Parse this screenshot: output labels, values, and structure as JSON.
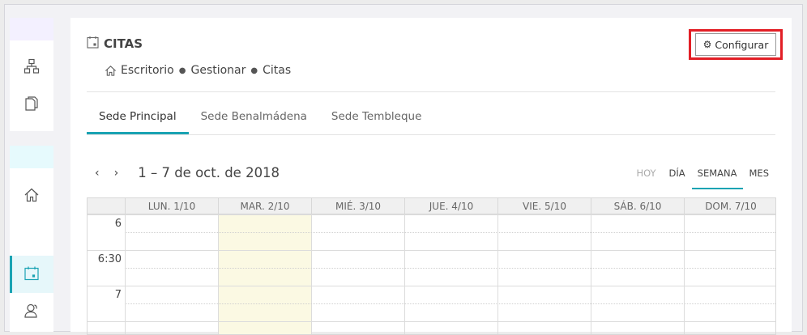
{
  "header": {
    "title": "CITAS",
    "configure_label": "Configurar"
  },
  "breadcrumb": [
    "Escritorio",
    "Gestionar",
    "Citas"
  ],
  "tabs": [
    {
      "label": "Sede Principal",
      "active": true
    },
    {
      "label": "Sede Benalmádena",
      "active": false
    },
    {
      "label": "Sede Tembleque",
      "active": false
    }
  ],
  "calendar": {
    "date_range": "1 – 7 de oct. de 2018",
    "views": {
      "today": "HOY",
      "day": "DÍA",
      "week": "SEMANA",
      "month": "MES"
    },
    "active_view": "SEMANA",
    "days": [
      "LUN. 1/10",
      "MAR. 2/10",
      "MIÉ. 3/10",
      "JUE. 4/10",
      "VIE. 5/10",
      "SÁB. 6/10",
      "DOM. 7/10"
    ],
    "today_day": "MAR. 2/10",
    "time_slots": [
      "6",
      "6:30",
      "7"
    ]
  },
  "sidebar": {
    "icons": [
      "sitemap-icon",
      "documents-icon",
      "home-icon",
      "calendar-icon",
      "users-icon"
    ]
  },
  "colors": {
    "accent": "#1aa3b3",
    "highlight": "#e21f26",
    "today_column": "#fbf9e3"
  }
}
